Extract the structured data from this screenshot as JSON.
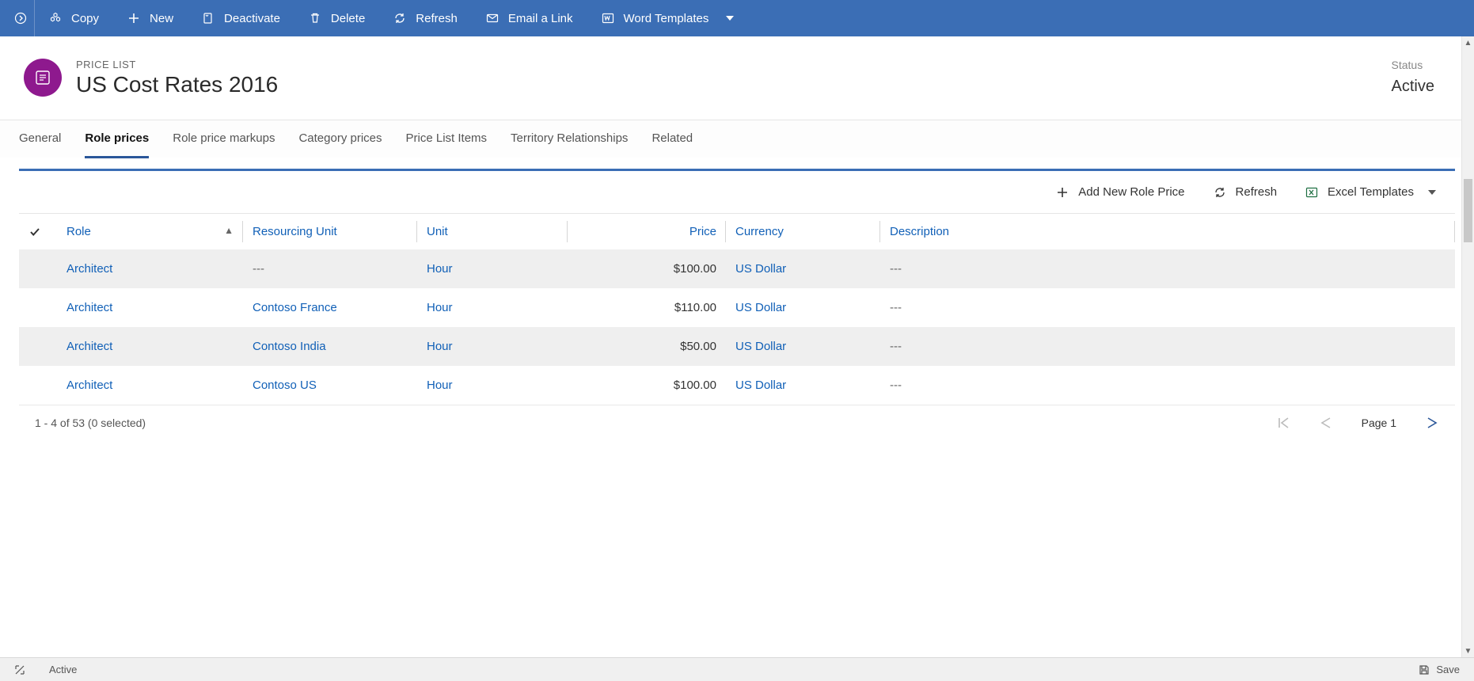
{
  "commandBar": {
    "copy": "Copy",
    "new": "New",
    "deactivate": "Deactivate",
    "delete": "Delete",
    "refresh": "Refresh",
    "emailLink": "Email a Link",
    "wordTemplates": "Word Templates"
  },
  "header": {
    "entityType": "PRICE LIST",
    "title": "US Cost Rates 2016",
    "statusLabel": "Status",
    "statusValue": "Active"
  },
  "tabs": [
    {
      "label": "General",
      "active": false
    },
    {
      "label": "Role prices",
      "active": true
    },
    {
      "label": "Role price markups",
      "active": false
    },
    {
      "label": "Category prices",
      "active": false
    },
    {
      "label": "Price List Items",
      "active": false
    },
    {
      "label": "Territory Relationships",
      "active": false
    },
    {
      "label": "Related",
      "active": false
    }
  ],
  "subgridToolbar": {
    "addNew": "Add New Role Price",
    "refresh": "Refresh",
    "excelTemplates": "Excel Templates"
  },
  "columns": {
    "role": "Role",
    "resourcingUnit": "Resourcing Unit",
    "unit": "Unit",
    "price": "Price",
    "currency": "Currency",
    "description": "Description"
  },
  "rows": [
    {
      "role": "Architect",
      "resourcingUnit": "---",
      "unit": "Hour",
      "price": "$100.00",
      "currency": "US Dollar",
      "description": "---"
    },
    {
      "role": "Architect",
      "resourcingUnit": "Contoso France",
      "unit": "Hour",
      "price": "$110.00",
      "currency": "US Dollar",
      "description": "---"
    },
    {
      "role": "Architect",
      "resourcingUnit": "Contoso India",
      "unit": "Hour",
      "price": "$50.00",
      "currency": "US Dollar",
      "description": "---"
    },
    {
      "role": "Architect",
      "resourcingUnit": "Contoso US",
      "unit": "Hour",
      "price": "$100.00",
      "currency": "US Dollar",
      "description": "---"
    }
  ],
  "gridFooter": {
    "summary": "1 - 4 of 53 (0 selected)",
    "pageLabel": "Page 1"
  },
  "statusBar": {
    "status": "Active",
    "save": "Save"
  }
}
